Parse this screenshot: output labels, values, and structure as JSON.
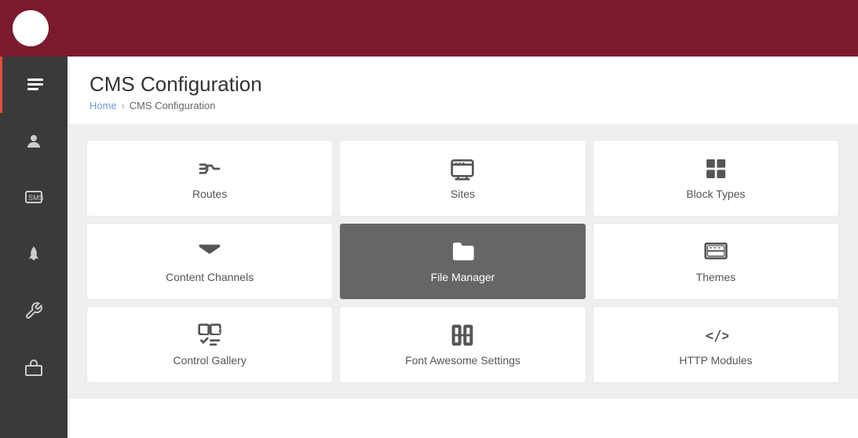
{
  "topbar": {
    "logo_symbol": "⛪"
  },
  "sidebar": {
    "items": [
      {
        "id": "content",
        "label": "Content",
        "icon": "content-icon",
        "active": true
      },
      {
        "id": "person",
        "label": "Person",
        "icon": "person-icon",
        "active": false
      },
      {
        "id": "sms",
        "label": "SMS",
        "icon": "sms-icon",
        "active": false
      },
      {
        "id": "rocket",
        "label": "Rocket",
        "icon": "rocket-icon",
        "active": false
      },
      {
        "id": "wrench",
        "label": "Wrench",
        "icon": "wrench-icon",
        "active": false
      },
      {
        "id": "toolbox",
        "label": "Toolbox",
        "icon": "toolbox-icon",
        "active": false
      }
    ]
  },
  "page": {
    "title": "CMS Configuration",
    "breadcrumb": {
      "home": "Home",
      "separator": "›",
      "current": "CMS Configuration"
    }
  },
  "grid": {
    "cards": [
      {
        "id": "routes",
        "label": "Routes",
        "icon": "routes"
      },
      {
        "id": "sites",
        "label": "Sites",
        "icon": "sites"
      },
      {
        "id": "block-types",
        "label": "Block Types",
        "icon": "block-types"
      },
      {
        "id": "content-channels",
        "label": "Content Channels",
        "icon": "content-channels"
      },
      {
        "id": "file-manager",
        "label": "File Manager",
        "icon": "file-manager",
        "active": true
      },
      {
        "id": "themes",
        "label": "Themes",
        "icon": "themes"
      },
      {
        "id": "control-gallery",
        "label": "Control Gallery",
        "icon": "control-gallery"
      },
      {
        "id": "font-awesome",
        "label": "Font Awesome Settings",
        "icon": "font-awesome"
      },
      {
        "id": "http-modules",
        "label": "HTTP Modules",
        "icon": "http-modules"
      }
    ]
  }
}
